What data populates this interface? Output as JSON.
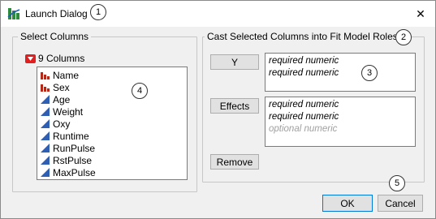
{
  "window": {
    "title": "Launch Dialog",
    "close_glyph": "✕"
  },
  "callouts": [
    "1",
    "2",
    "3",
    "4",
    "5"
  ],
  "select_columns": {
    "group_label": "Select Columns",
    "tree_label": "9 Columns",
    "columns": [
      {
        "name": "Name",
        "type": "nominal"
      },
      {
        "name": "Sex",
        "type": "nominal"
      },
      {
        "name": "Age",
        "type": "continuous"
      },
      {
        "name": "Weight",
        "type": "continuous"
      },
      {
        "name": "Oxy",
        "type": "continuous"
      },
      {
        "name": "Runtime",
        "type": "continuous"
      },
      {
        "name": "RunPulse",
        "type": "continuous"
      },
      {
        "name": "RstPulse",
        "type": "continuous"
      },
      {
        "name": "MaxPulse",
        "type": "continuous"
      }
    ]
  },
  "roles": {
    "group_label": "Cast Selected Columns into Fit Model Roles",
    "y_button": "Y",
    "y_lines": [
      "required numeric",
      "required numeric"
    ],
    "effects_button": "Effects",
    "effects_lines": [
      "required numeric",
      "required numeric"
    ],
    "effects_optional": "optional numeric",
    "remove_button": "Remove"
  },
  "footer": {
    "ok": "OK",
    "cancel": "Cancel"
  },
  "colors": {
    "nominal_icon": "#b22a1a",
    "continuous_icon": "#2f5fb3",
    "toggle": "#e02020",
    "focus_border": "#0078d7"
  }
}
